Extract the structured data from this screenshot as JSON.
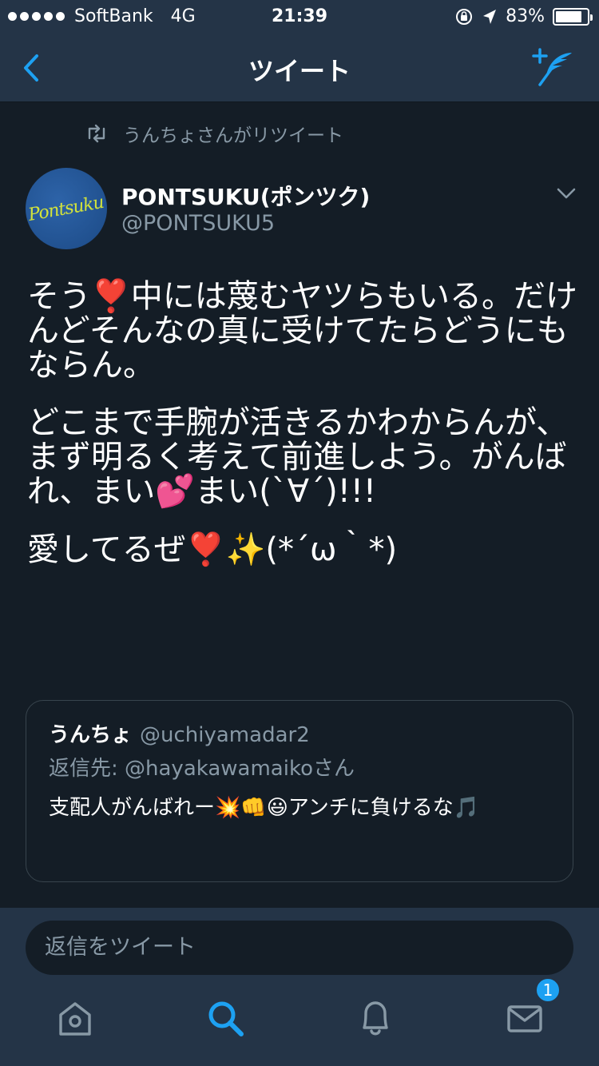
{
  "status_bar": {
    "carrier": "SoftBank",
    "network": "4G",
    "time": "21:39",
    "battery": "83%",
    "battery_level": 0.83
  },
  "nav": {
    "title": "ツイート",
    "back_icon": "chevron-left-icon",
    "compose_icon": "compose-tweet-icon"
  },
  "retweet_context": {
    "icon": "retweet-icon",
    "text": "うんちょさんがリツイート"
  },
  "tweet": {
    "avatar_logo_text": "Pontsuku",
    "display_name": "PONTSUKU(ポンツク)",
    "handle": "@PONTSUKU5",
    "paragraphs": [
      "そう❣️中には蔑むヤツらもいる。だけんどそんなの真に受けてたらどうにもならん。",
      "どこまで手腕が活きるかわからんが、まず明るく考えて前進しよう。がんばれ、まい💕まい(`∀´)!!!",
      "愛してるぜ❣️✨(*´ω｀*)"
    ]
  },
  "quote": {
    "name": "うんちょ",
    "handle": "@uchiyamadar2",
    "reply_to": "返信先: @hayakawamaikoさん",
    "text": "支配人がんばれー💥👊😃アンチに負けるな🎵"
  },
  "reply": {
    "placeholder": "返信をツイート"
  },
  "tab_bar": {
    "items": [
      "home-icon",
      "search-icon",
      "notifications-icon",
      "messages-icon"
    ],
    "messages_badge": "1",
    "active_color": "#1da1f2",
    "inactive_color": "#8899a6"
  }
}
